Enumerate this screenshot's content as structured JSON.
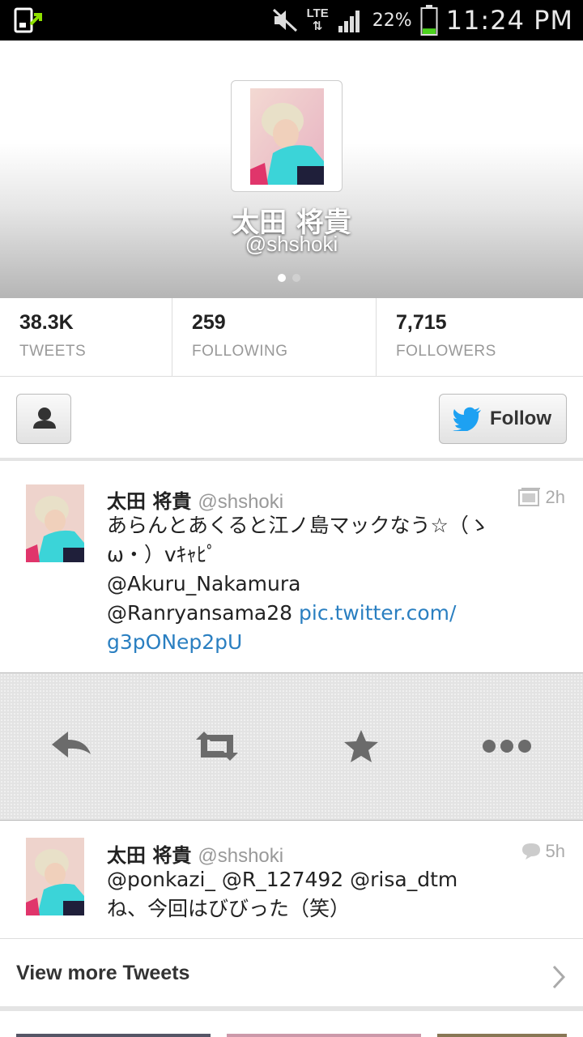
{
  "status_bar": {
    "network": "LTE",
    "battery": "22%",
    "battery_level_percent": 22,
    "time": "11:24 PM"
  },
  "profile": {
    "display_name": "太田 将貴",
    "handle": "@shshoki",
    "page_indicator": {
      "count": 2,
      "active": 1
    }
  },
  "stats": [
    {
      "value": "38.3K",
      "label": "TWEETS"
    },
    {
      "value": "259",
      "label": "FOLLOWING"
    },
    {
      "value": "7,715",
      "label": "FOLLOWERS"
    }
  ],
  "actions": {
    "follow_label": "Follow"
  },
  "tweets": [
    {
      "name": "太田 将貴",
      "handle": "@shshoki",
      "time": "2h",
      "icon": "media-icon",
      "line1": "あらんとあくると江ノ島マックなう☆（ゝ",
      "line2": "ω・）vｷｬﾋﾟ",
      "line3": "@Akuru_Nakamura",
      "line4_text": "@Ranryansama28 ",
      "line4_link": "pic.twitter.com/",
      "line5_link": "g3pONep2pU"
    },
    {
      "name": "太田 将貴",
      "handle": "@shshoki",
      "time": "5h",
      "icon": "reply-bubble-icon",
      "line1": "@ponkazi_ @R_127492 @risa_dtm",
      "line2": "ね、今回はびびった（笑）"
    }
  ],
  "tweet_actions": [
    "reply-icon",
    "retweet-icon",
    "favorite-icon",
    "more-icon"
  ],
  "view_more_label": "View more Tweets",
  "colors": {
    "link": "#2a7fc1",
    "twitter_blue": "#1da1f2",
    "battery_green": "#4cd31e"
  }
}
